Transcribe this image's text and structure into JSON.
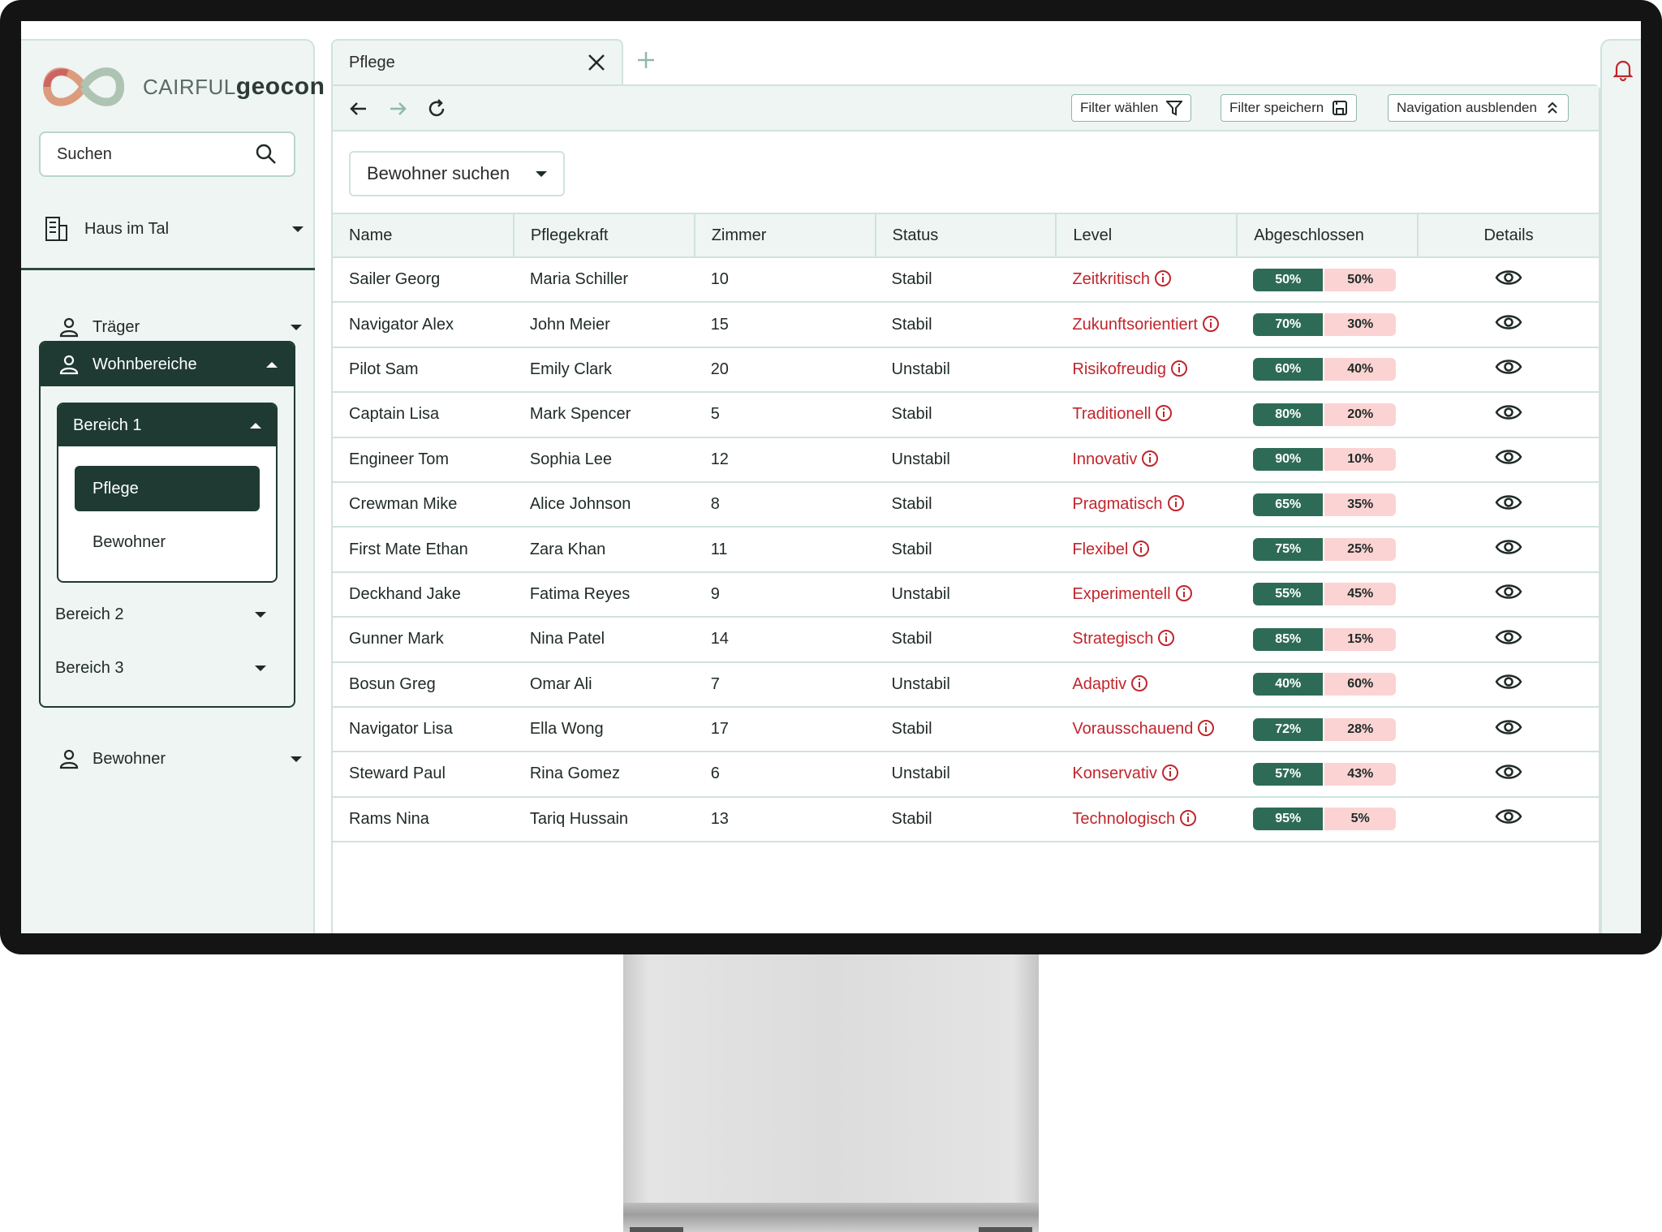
{
  "brand": {
    "name_light": "CAIRFUL",
    "name_bold": "geocon"
  },
  "sidebar": {
    "search_placeholder": "Suchen",
    "house": "Haus im Tal",
    "traeger": "Träger",
    "wohnbereiche": "Wohnbereiche",
    "bereich1": "Bereich 1",
    "bereich1_items": [
      "Pflege",
      "Bewohner"
    ],
    "bereich2": "Bereich 2",
    "bereich3": "Bereich 3",
    "bewohner": "Bewohner"
  },
  "tab": {
    "label": "Pflege"
  },
  "toolbar": {
    "filter_waehlen": "Filter wählen",
    "filter_speichern": "Filter speichern",
    "navigation_ausblenden": "Navigation ausblenden"
  },
  "resident_search": "Bewohner suchen",
  "table": {
    "headers": [
      "Name",
      "Pflegekraft",
      "Zimmer",
      "Status",
      "Level",
      "Abgeschlossen",
      "Details"
    ],
    "rows": [
      {
        "name": "Sailer Georg",
        "nurse": "Maria Schiller",
        "room": "10",
        "status": "Stabil",
        "level": "Zeitkritisch",
        "done": "50%",
        "open": "50%",
        "done_frac": 0.5
      },
      {
        "name": "Navigator Alex",
        "nurse": "John Meier",
        "room": "15",
        "status": "Stabil",
        "level": "Zukunftsorientiert",
        "done": "70%",
        "open": "30%",
        "done_frac": 0.5
      },
      {
        "name": "Pilot Sam",
        "nurse": "Emily Clark",
        "room": "20",
        "status": "Unstabil",
        "level": "Risikofreudig",
        "done": "60%",
        "open": "40%",
        "done_frac": 0.5
      },
      {
        "name": "Captain Lisa",
        "nurse": "Mark Spencer",
        "room": "5",
        "status": "Stabil",
        "level": "Traditionell",
        "done": "80%",
        "open": "20%",
        "done_frac": 0.5
      },
      {
        "name": "Engineer Tom",
        "nurse": "Sophia Lee",
        "room": "12",
        "status": "Unstabil",
        "level": "Innovativ",
        "done": "90%",
        "open": "10%",
        "done_frac": 0.5
      },
      {
        "name": "Crewman Mike",
        "nurse": "Alice Johnson",
        "room": "8",
        "status": "Stabil",
        "level": "Pragmatisch",
        "done": "65%",
        "open": "35%",
        "done_frac": 0.5
      },
      {
        "name": "First Mate Ethan",
        "nurse": "Zara Khan",
        "room": "11",
        "status": "Stabil",
        "level": "Flexibel",
        "done": "75%",
        "open": "25%",
        "done_frac": 0.5
      },
      {
        "name": "Deckhand Jake",
        "nurse": "Fatima Reyes",
        "room": "9",
        "status": "Unstabil",
        "level": "Experimentell",
        "done": "55%",
        "open": "45%",
        "done_frac": 0.5
      },
      {
        "name": "Gunner Mark",
        "nurse": "Nina Patel",
        "room": "14",
        "status": "Stabil",
        "level": "Strategisch",
        "done": "85%",
        "open": "15%",
        "done_frac": 0.5
      },
      {
        "name": "Bosun Greg",
        "nurse": "Omar Ali",
        "room": "7",
        "status": "Unstabil",
        "level": "Adaptiv",
        "done": "40%",
        "open": "60%",
        "done_frac": 0.5
      },
      {
        "name": "Navigator Lisa",
        "nurse": "Ella Wong",
        "room": "17",
        "status": "Stabil",
        "level": "Vorausschauend",
        "done": "72%",
        "open": "28%",
        "done_frac": 0.5
      },
      {
        "name": "Steward Paul",
        "nurse": "Rina Gomez",
        "room": "6",
        "status": "Unstabil",
        "level": "Konservativ",
        "done": "57%",
        "open": "43%",
        "done_frac": 0.5
      },
      {
        "name": "Rams Nina",
        "nurse": "Tariq Hussain",
        "room": "13",
        "status": "Stabil",
        "level": "Technologisch",
        "done": "95%",
        "open": "5%",
        "done_frac": 0.5
      }
    ]
  },
  "colors": {
    "dark_green": "#1e3a33",
    "progress_done": "#2e6b56",
    "progress_open": "#fbd3d3",
    "level_red": "#c0262d",
    "panel_bg": "#eef5f2"
  },
  "icons": [
    "search-icon",
    "building-icon",
    "person-icon",
    "close-icon",
    "plus-icon",
    "arrow-left-icon",
    "arrow-right-icon",
    "refresh-icon",
    "filter-icon",
    "save-icon",
    "chevrons-up-icon",
    "eye-icon",
    "info-icon",
    "bell-icon"
  ]
}
